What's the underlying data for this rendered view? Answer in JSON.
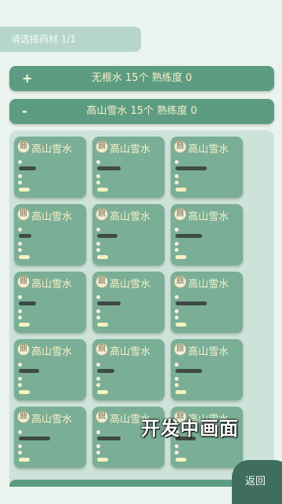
{
  "header": {
    "prompt": "请选择药材 1/1"
  },
  "categories": [
    {
      "sign": "+",
      "label": "无根水 15个  熟练度 0"
    },
    {
      "sign": "-",
      "label": "高山雪水 15个  熟练度 0"
    }
  ],
  "items": [
    {
      "name": "高山雪水",
      "icon_char": "鼎"
    },
    {
      "name": "高山雪水",
      "icon_char": "鼎"
    },
    {
      "name": "高山雪水",
      "icon_char": "鼎"
    },
    {
      "name": "高山雪水",
      "icon_char": "鼎"
    },
    {
      "name": "高山雪水",
      "icon_char": "鼎"
    },
    {
      "name": "高山雪水",
      "icon_char": "鼎"
    },
    {
      "name": "高山雪水",
      "icon_char": "鼎"
    },
    {
      "name": "高山雪水",
      "icon_char": "鼎"
    },
    {
      "name": "高山雪水",
      "icon_char": "鼎"
    },
    {
      "name": "高山雪水",
      "icon_char": "鼎"
    },
    {
      "name": "高山雪水",
      "icon_char": "鼎"
    },
    {
      "name": "高山雪水",
      "icon_char": "鼎"
    },
    {
      "name": "高山雪水",
      "icon_char": "鼎"
    },
    {
      "name": "高山雪水",
      "icon_char": "鼎"
    },
    {
      "name": "高山雪水",
      "icon_char": "鼎"
    }
  ],
  "overlay": {
    "text": "开发中画面"
  },
  "back_button": {
    "label": "返回"
  }
}
